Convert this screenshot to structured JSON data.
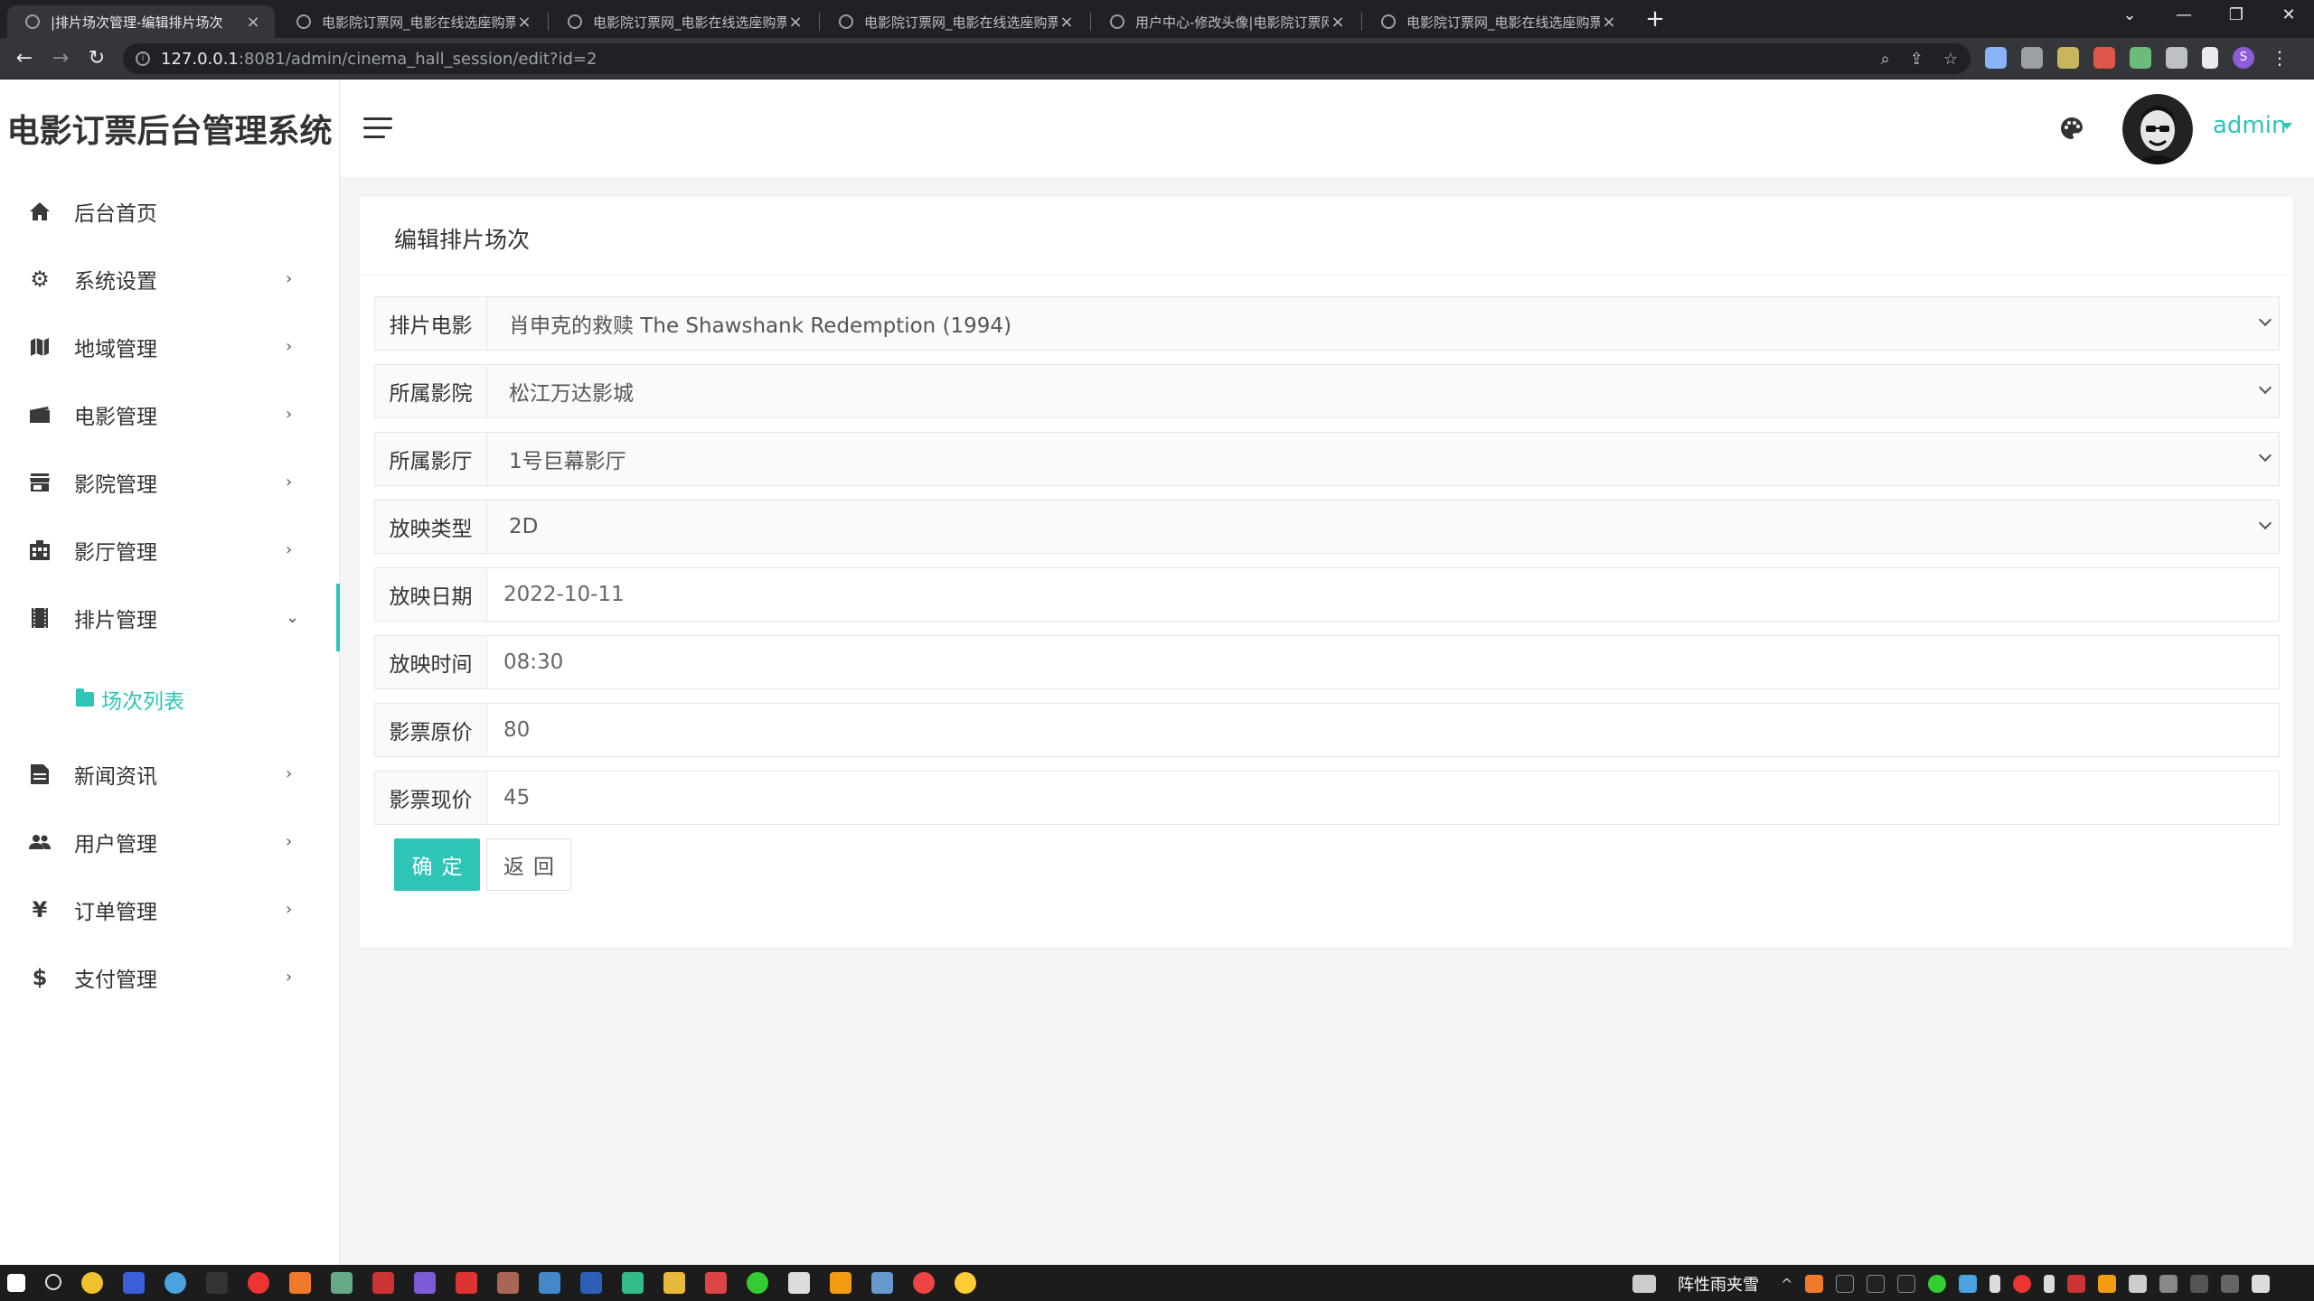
{
  "browser": {
    "tabs": [
      {
        "title": "|排片场次管理-编辑排片场次",
        "active": true
      },
      {
        "title": "电影院订票网_电影在线选座购票",
        "active": false
      },
      {
        "title": "电影院订票网_电影在线选座购票",
        "active": false
      },
      {
        "title": "电影院订票网_电影在线选座购票",
        "active": false
      },
      {
        "title": "用户中心-修改头像|电影院订票网",
        "active": false
      },
      {
        "title": "电影院订票网_电影在线选座购票",
        "active": false
      }
    ],
    "url_host": "127.0.0.1",
    "url_rest": ":8081/admin/cinema_hall_session/edit?id=2",
    "profile_initial": "S"
  },
  "header": {
    "app_title": "电影订票后台管理系统",
    "user_name": "admin"
  },
  "sidebar": {
    "items": [
      {
        "label": "后台首页",
        "icon": "home-icon",
        "has_arrow": false
      },
      {
        "label": "系统设置",
        "icon": "gear-icon",
        "has_arrow": true
      },
      {
        "label": "地域管理",
        "icon": "map-icon",
        "has_arrow": true
      },
      {
        "label": "电影管理",
        "icon": "film-icon",
        "has_arrow": true
      },
      {
        "label": "影院管理",
        "icon": "store-icon",
        "has_arrow": true
      },
      {
        "label": "影厅管理",
        "icon": "building-icon",
        "has_arrow": true
      },
      {
        "label": "排片管理",
        "icon": "schedule-icon",
        "has_arrow": true,
        "open": true
      },
      {
        "label": "新闻资讯",
        "icon": "news-icon",
        "has_arrow": true
      },
      {
        "label": "用户管理",
        "icon": "users-icon",
        "has_arrow": true
      },
      {
        "label": "订单管理",
        "icon": "yen-icon",
        "has_arrow": true
      },
      {
        "label": "支付管理",
        "icon": "dollar-icon",
        "has_arrow": true
      }
    ],
    "submenu": {
      "label": "场次列表",
      "icon": "folder-icon"
    }
  },
  "form": {
    "title": "编辑排片场次",
    "fields": {
      "movie": {
        "label": "排片电影",
        "value": "肖申克的救赎 The Shawshank Redemption (1994)"
      },
      "cinema": {
        "label": "所属影院",
        "value": "松江万达影城"
      },
      "hall": {
        "label": "所属影厅",
        "value": "1号巨幕影厅"
      },
      "type": {
        "label": "放映类型",
        "value": "2D"
      },
      "date": {
        "label": "放映日期",
        "value": "2022-10-11"
      },
      "time": {
        "label": "放映时间",
        "value": "08:30"
      },
      "old_price": {
        "label": "影票原价",
        "value": "80"
      },
      "new_price": {
        "label": "影票现价",
        "value": "45"
      }
    },
    "confirm_label": "确定",
    "back_label": "返回"
  },
  "taskbar": {
    "weather": "阵性雨夹雪"
  },
  "colors": {
    "accent": "#2ec4b6",
    "chrome_dark": "#202124",
    "chrome_mid": "#35363a"
  }
}
